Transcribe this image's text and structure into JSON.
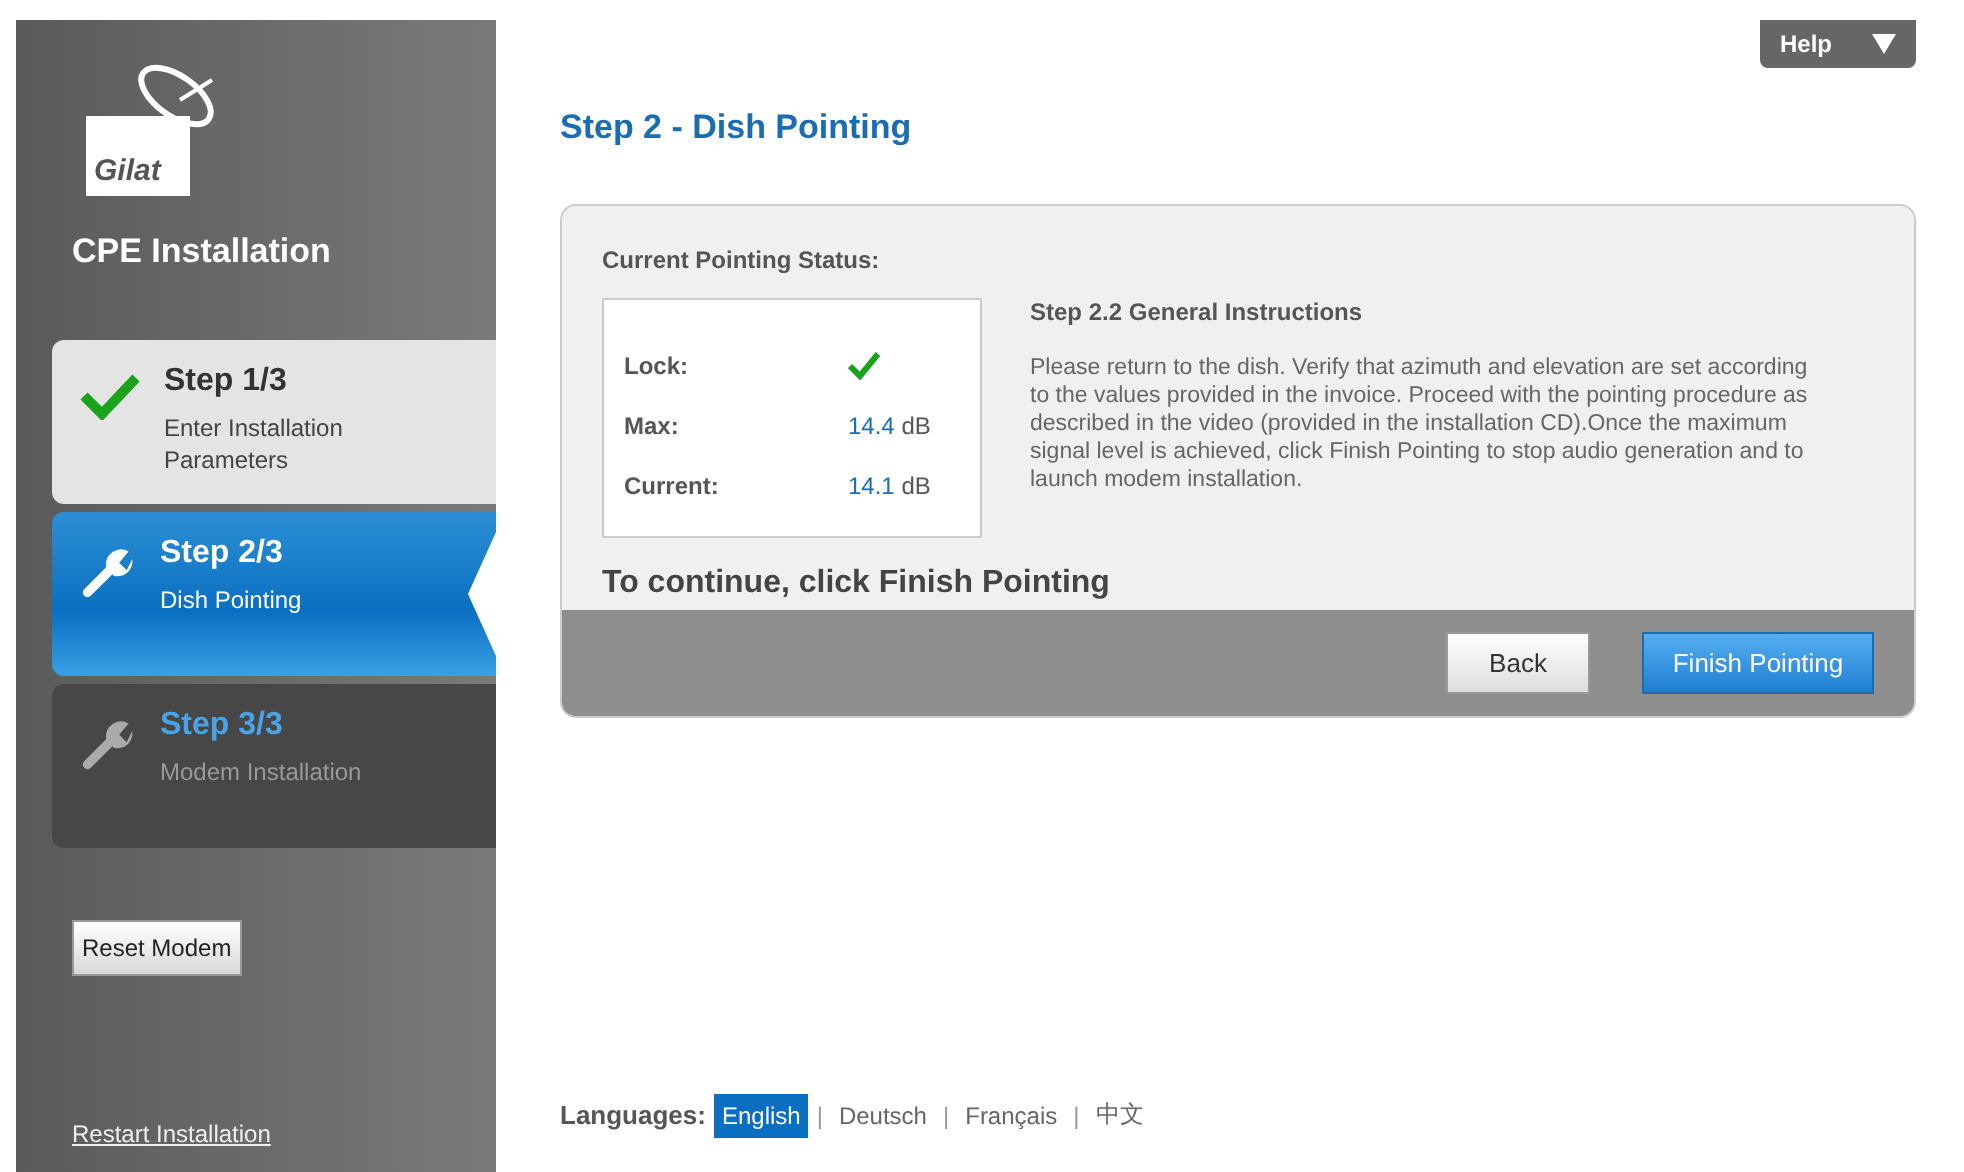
{
  "help_button": {
    "label": "Help"
  },
  "sidebar": {
    "logo": "Gilat",
    "title": "CPE Installation",
    "steps": [
      {
        "kind": "done",
        "title": "Step 1/3",
        "subtitle": "Enter Installation Parameters",
        "selected": false
      },
      {
        "kind": "active",
        "title": "Step 2/3",
        "subtitle": "Dish Pointing",
        "selected": true
      },
      {
        "kind": "pending",
        "title": "Step 3/3",
        "subtitle": "Modem Installation",
        "selected": false
      }
    ],
    "reset_button": "Reset Modem",
    "restart_link": "Restart Installation"
  },
  "page_title": "Step 2 - Dish Pointing",
  "status": {
    "heading": "Current Pointing Status:",
    "rows": [
      {
        "kind": "check",
        "label": "Lock:",
        "locked": true
      },
      {
        "kind": "reading",
        "label": "Max:",
        "value": "14.4",
        "unit": "dB"
      },
      {
        "kind": "reading",
        "label": "Current:",
        "value": "14.1",
        "unit": "dB"
      }
    ]
  },
  "instructions": {
    "title": "Step 2.2 General Instructions",
    "text": "Please return to the dish. Verify that azimuth and elevation are set according to the values provided in the invoice. Proceed with the pointing procedure as described in the video (provided in the installation CD).Once the maximum signal level is achieved, click Finish Pointing to stop audio generation and to launch modem installation."
  },
  "continue_text": "To continue, click Finish Pointing",
  "buttons": [
    {
      "label": "Back",
      "primary": false
    },
    {
      "label": "Finish Pointing",
      "primary": true
    }
  ],
  "languages": {
    "label": "Languages:",
    "separator": "|",
    "items": [
      {
        "label": "English",
        "selected": true
      },
      {
        "label": "Deutsch",
        "selected": false
      },
      {
        "label": "Français",
        "selected": false
      },
      {
        "label": "中文",
        "selected": false
      }
    ]
  }
}
